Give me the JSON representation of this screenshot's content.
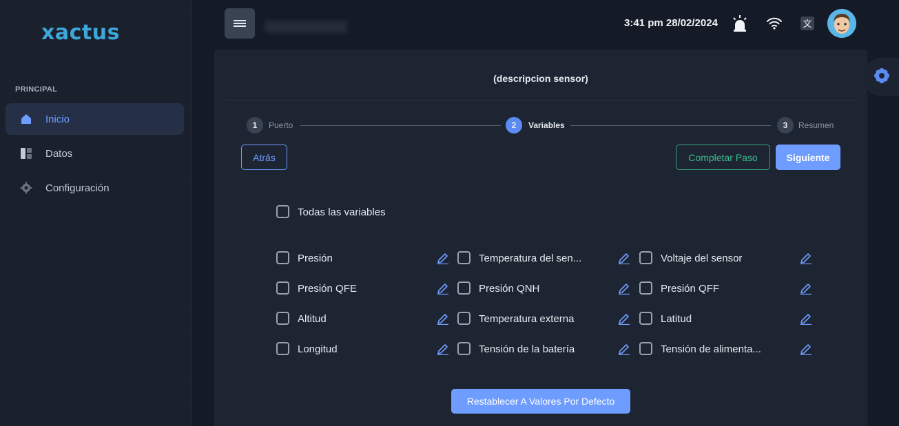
{
  "sidebar": {
    "logo": "xactus",
    "section": "PRINCIPAL",
    "items": [
      {
        "label": "Inicio",
        "icon": "home-icon",
        "active": true
      },
      {
        "label": "Datos",
        "icon": "dashboard-icon",
        "active": false
      },
      {
        "label": "Configuración",
        "icon": "gear-icon",
        "active": false
      }
    ]
  },
  "header": {
    "datetime": "3:41 pm 28/02/2024",
    "icons": [
      "alarm-icon",
      "wifi-icon",
      "translate-icon"
    ]
  },
  "card": {
    "title": "(descripcion sensor)",
    "steps": [
      {
        "num": "1",
        "label": "Puerto"
      },
      {
        "num": "2",
        "label": "Variables"
      },
      {
        "num": "3",
        "label": "Resumen"
      }
    ],
    "active_step": 2,
    "buttons": {
      "back": "Atrás",
      "complete": "Completar Paso",
      "next": "Siguiente",
      "reset": "Restablecer A Valores Por Defecto"
    },
    "all_variables": "Todas las variables",
    "variables": [
      "Presión",
      "Temperatura del sen...",
      "Voltaje del sensor",
      "Presión QFE",
      "Presión QNH",
      "Presión QFF",
      "Altitud",
      "Temperatura externa",
      "Latitud",
      "Longitud",
      "Tensión de la batería",
      "Tensión de alimenta..."
    ]
  },
  "colors": {
    "accent": "#6f9cff",
    "success": "#3cbf8d",
    "logo": "#3ea6d8"
  }
}
